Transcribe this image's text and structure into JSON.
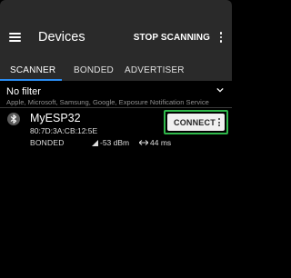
{
  "appbar": {
    "title": "Devices",
    "stop_label": "STOP SCANNING",
    "menu_icon": "hamburger-icon",
    "more_icon": "more-vert-icon"
  },
  "tabs": [
    {
      "label": "SCANNER",
      "selected": true
    },
    {
      "label": "BONDED",
      "selected": false
    },
    {
      "label": "ADVERTISER",
      "selected": false
    }
  ],
  "filter": {
    "title": "No filter",
    "subtitle": "Apple, Microsoft, Samsung, Google, Exposure Notification Service",
    "expand_icon": "chevron-down-icon"
  },
  "device": {
    "name": "MyESP32",
    "mac": "80:7D:3A:CB:12:5E",
    "state": "BONDED",
    "rssi": "-53 dBm",
    "interval": "44 ms",
    "connect_label": "CONNECT",
    "icon": "bluetooth-icon"
  },
  "colors": {
    "accent": "#2a8cf2",
    "highlight": "#2fb84a",
    "appbar": "#2a2a2a",
    "background": "#000000"
  }
}
